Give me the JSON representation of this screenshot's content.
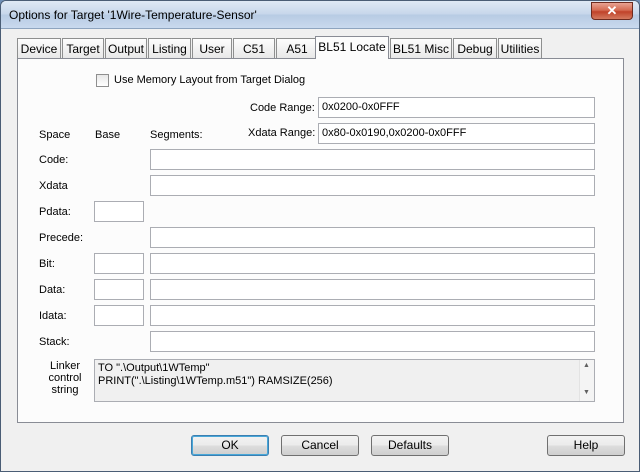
{
  "window": {
    "title": "Options for Target '1Wire-Temperature-Sensor'",
    "close_glyph": "✕"
  },
  "tabs": [
    {
      "label": "Device"
    },
    {
      "label": "Target"
    },
    {
      "label": "Output"
    },
    {
      "label": "Listing"
    },
    {
      "label": "User"
    },
    {
      "label": "C51"
    },
    {
      "label": "A51"
    },
    {
      "label": "BL51 Locate",
      "active": true
    },
    {
      "label": "BL51 Misc"
    },
    {
      "label": "Debug"
    },
    {
      "label": "Utilities"
    }
  ],
  "use_memory_layout": {
    "label": "Use Memory Layout from Target Dialog",
    "checked": false
  },
  "code_range": {
    "label": "Code Range:",
    "value": "0x0200-0x0FFF"
  },
  "xdata_range": {
    "label": "Xdata Range:",
    "value": "0x80-0x0190,0x0200-0x0FFF"
  },
  "columns": {
    "space": "Space",
    "base": "Base",
    "segments": "Segments:"
  },
  "rows": [
    {
      "label": "Code:",
      "base": "",
      "segments": ""
    },
    {
      "label": "Xdata",
      "base": "",
      "segments": ""
    },
    {
      "label": "Pdata:",
      "base": "",
      "segments": ""
    },
    {
      "label": "Precede:",
      "base": "",
      "segments": ""
    },
    {
      "label": "Bit:",
      "base": "",
      "segments": ""
    },
    {
      "label": "Data:",
      "base": "",
      "segments": ""
    },
    {
      "label": "Idata:",
      "base": "",
      "segments": ""
    },
    {
      "label": "Stack:",
      "base": "",
      "segments": ""
    }
  ],
  "linker": {
    "label_line1": "Linker",
    "label_line2": "control",
    "label_line3": "string",
    "value": "TO \".\\Output\\1WTemp\"\nPRINT(\".\\Listing\\1WTemp.m51\") RAMSIZE(256)"
  },
  "buttons": {
    "ok": "OK",
    "cancel": "Cancel",
    "defaults": "Defaults",
    "help": "Help"
  }
}
